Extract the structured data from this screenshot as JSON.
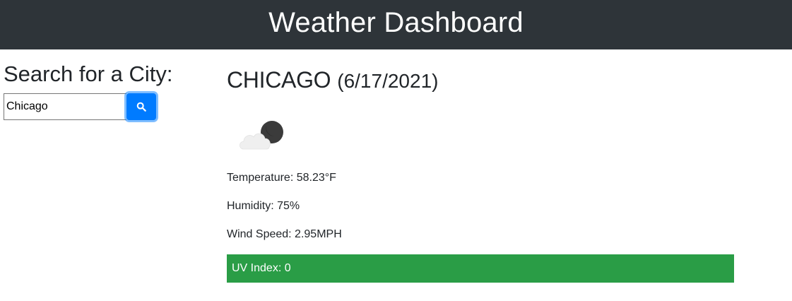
{
  "header": {
    "title": "Weather Dashboard"
  },
  "sidebar": {
    "heading": "Search for a City:",
    "search_value": "Chicago",
    "search_icon": "search-icon"
  },
  "current": {
    "city": "CHICAGO",
    "date": "(6/17/2021)",
    "icon": "partly-cloudy-night-icon",
    "temperature": "Temperature: 58.23°F",
    "humidity": "Humidity: 75%",
    "wind": "Wind Speed: 2.95MPH",
    "uv": "UV Index: 0",
    "uv_color": "#2a9d46"
  },
  "colors": {
    "header_bg": "#2e3439",
    "accent": "#007bff"
  }
}
